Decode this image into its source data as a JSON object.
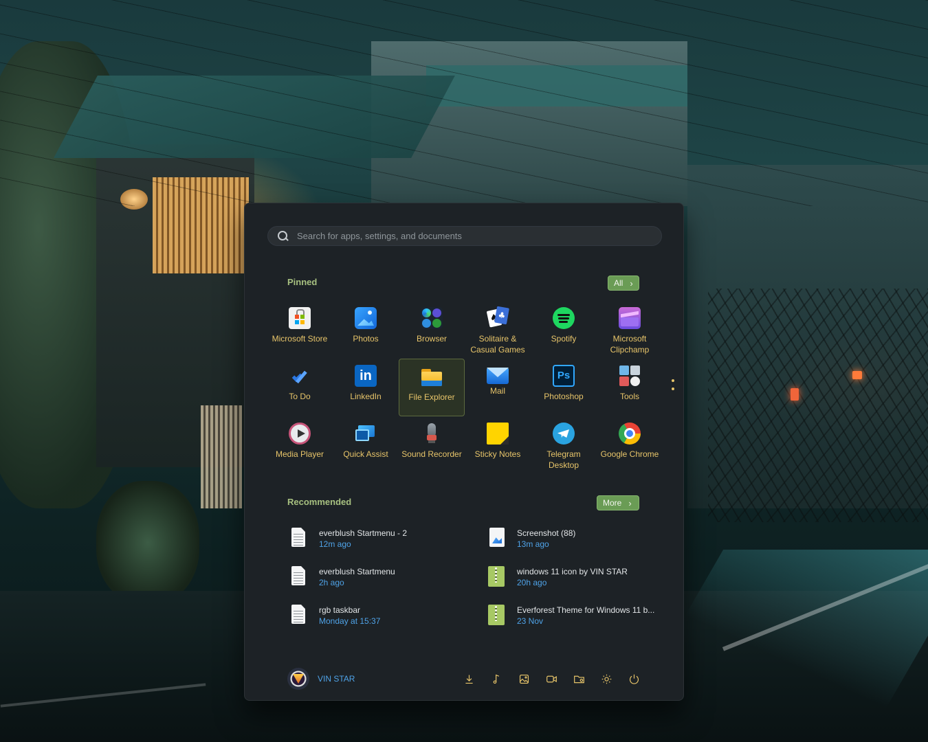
{
  "search": {
    "placeholder": "Search for apps, settings, and documents"
  },
  "pinned": {
    "title": "Pinned",
    "all_button": "All",
    "apps": [
      {
        "label": "Microsoft Store",
        "icon": "microsoft-store-icon"
      },
      {
        "label": "Photos",
        "icon": "photos-icon"
      },
      {
        "label": "Browser",
        "icon": "browser-icon"
      },
      {
        "label": "Solitaire &\nCasual Games",
        "icon": "solitaire-icon"
      },
      {
        "label": "Spotify",
        "icon": "spotify-icon"
      },
      {
        "label": "Microsoft\nClipchamp",
        "icon": "clipchamp-icon"
      },
      {
        "label": "To Do",
        "icon": "todo-icon"
      },
      {
        "label": "LinkedIn",
        "icon": "linkedin-icon"
      },
      {
        "label": "File Explorer",
        "icon": "file-explorer-icon",
        "selected": true
      },
      {
        "label": "Mail",
        "icon": "mail-icon"
      },
      {
        "label": "Photoshop",
        "icon": "photoshop-icon"
      },
      {
        "label": "Tools",
        "icon": "tools-icon"
      },
      {
        "label": "Media Player",
        "icon": "media-player-icon"
      },
      {
        "label": "Quick Assist",
        "icon": "quick-assist-icon"
      },
      {
        "label": "Sound Recorder",
        "icon": "sound-recorder-icon"
      },
      {
        "label": "Sticky Notes",
        "icon": "sticky-notes-icon"
      },
      {
        "label": "Telegram\nDesktop",
        "icon": "telegram-icon"
      },
      {
        "label": "Google Chrome",
        "icon": "chrome-icon"
      }
    ]
  },
  "recommended": {
    "title": "Recommended",
    "more_button": "More",
    "items": [
      {
        "name": "everblush Startmenu - 2",
        "time": "12m ago",
        "icon": "document-icon"
      },
      {
        "name": "Screenshot (88)",
        "time": "13m ago",
        "icon": "image-file-icon"
      },
      {
        "name": "everblush Startmenu",
        "time": "2h ago",
        "icon": "document-icon"
      },
      {
        "name": "windows 11 icon by VIN STAR",
        "time": "20h ago",
        "icon": "zip-file-icon"
      },
      {
        "name": "rgb taskbar",
        "time": "Monday at 15:37",
        "icon": "document-icon"
      },
      {
        "name": "Everforest Theme for Windows 11 b...",
        "time": "23 Nov",
        "icon": "zip-file-icon"
      }
    ]
  },
  "user": {
    "name": "VIN STAR"
  },
  "footer_icons": [
    "downloads-icon",
    "music-icon",
    "pictures-icon",
    "videos-icon",
    "personal-folder-icon",
    "settings-icon",
    "power-icon"
  ],
  "colors": {
    "accent_green": "#a7c080",
    "label_yellow": "#e8c56a",
    "time_blue": "#4fa3e8",
    "button_green": "#6a9c55",
    "panel_bg": "#1d2226"
  }
}
